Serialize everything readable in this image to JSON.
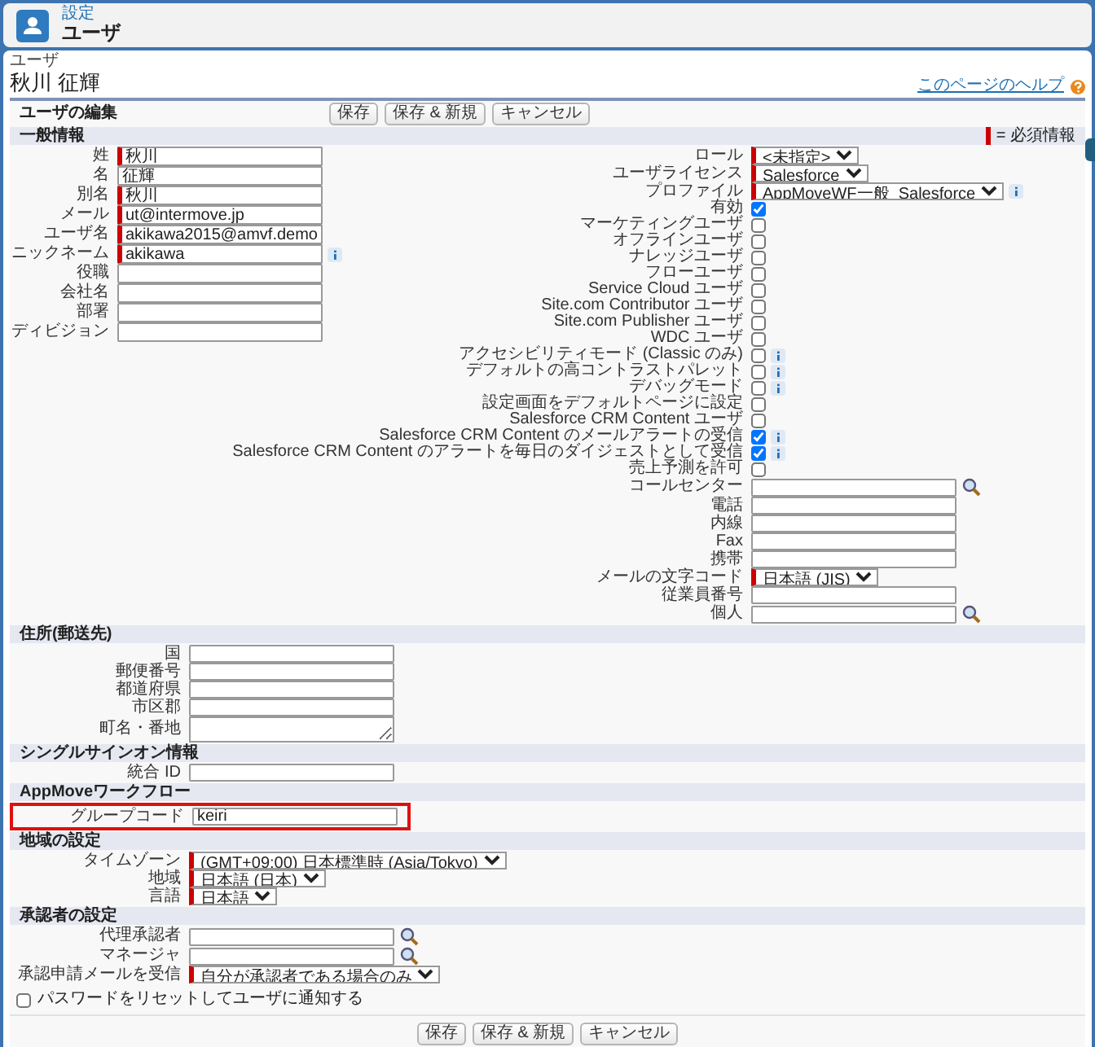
{
  "header": {
    "breadcrumb": "設定",
    "title": "ユーザ"
  },
  "record": {
    "type_label": "ユーザ",
    "name": "秋川 征輝",
    "help_link": "このページのヘルプ"
  },
  "edit_bar": {
    "title": "ユーザの編集",
    "buttons": [
      "保存",
      "保存 & 新規",
      "キャンセル"
    ]
  },
  "sections": [
    {
      "title": "一般情報",
      "required_legend": "= 必須情報",
      "left_fields": [
        {
          "kind": "text",
          "label": "姓",
          "value": "秋川",
          "required": true
        },
        {
          "kind": "text",
          "label": "名",
          "value": "征輝",
          "required": false
        },
        {
          "kind": "text",
          "label": "別名",
          "value": "秋川",
          "required": true
        },
        {
          "kind": "text",
          "label": "メール",
          "value": "ut@intermove.jp",
          "required": true
        },
        {
          "kind": "text",
          "label": "ユーザ名",
          "value": "akikawa2015@amvf.demo",
          "required": true
        },
        {
          "kind": "text",
          "label": "ニックネーム",
          "value": "akikawa",
          "required": true,
          "info": true
        },
        {
          "kind": "text",
          "label": "役職",
          "required": false
        },
        {
          "kind": "text",
          "label": "会社名",
          "required": false
        },
        {
          "kind": "text",
          "label": "部署",
          "required": false
        },
        {
          "kind": "text",
          "label": "ディビジョン",
          "required": false
        }
      ],
      "right_fields": [
        {
          "kind": "select",
          "label": "ロール",
          "value": "<未指定>",
          "required": true
        },
        {
          "kind": "select",
          "label": "ユーザライセンス",
          "value": "Salesforce",
          "required": true
        },
        {
          "kind": "select",
          "label": "プロファイル",
          "value": "AppMoveWF一般_Salesforce",
          "required": true,
          "info": true
        },
        {
          "kind": "checkbox",
          "label": "有効",
          "checked": true
        },
        {
          "kind": "checkbox",
          "label": "マーケティングユーザ",
          "checked": false
        },
        {
          "kind": "checkbox",
          "label": "オフラインユーザ",
          "checked": false
        },
        {
          "kind": "checkbox",
          "label": "ナレッジユーザ",
          "checked": false
        },
        {
          "kind": "checkbox",
          "label": "フローユーザ",
          "checked": false
        },
        {
          "kind": "checkbox",
          "label": "Service Cloud ユーザ",
          "checked": false
        },
        {
          "kind": "checkbox",
          "label": "Site.com Contributor ユーザ",
          "checked": false
        },
        {
          "kind": "checkbox",
          "label": "Site.com Publisher ユーザ",
          "checked": false
        },
        {
          "kind": "checkbox",
          "label": "WDC ユーザ",
          "checked": false
        },
        {
          "kind": "checkbox",
          "label": "アクセシビリティモード (Classic のみ)",
          "checked": false,
          "info": true
        },
        {
          "kind": "checkbox",
          "label": "デフォルトの高コントラストパレット",
          "checked": false,
          "info": true
        },
        {
          "kind": "checkbox",
          "label": "デバッグモード",
          "checked": false,
          "info": true
        },
        {
          "kind": "checkbox",
          "label": "設定画面をデフォルトページに設定",
          "checked": false
        },
        {
          "kind": "checkbox",
          "label": "Salesforce CRM Content ユーザ",
          "checked": false
        },
        {
          "kind": "checkbox",
          "label": "Salesforce CRM Content のメールアラートの受信",
          "checked": true,
          "info": true
        },
        {
          "kind": "checkbox",
          "label": "Salesforce CRM Content のアラートを毎日のダイジェストとして受信",
          "checked": true,
          "info": true
        },
        {
          "kind": "checkbox",
          "label": "売上予測を許可",
          "checked": false
        },
        {
          "kind": "lookup",
          "label": "コールセンター",
          "required": false
        },
        {
          "kind": "text",
          "label": "電話",
          "required": false
        },
        {
          "kind": "text",
          "label": "内線",
          "required": false
        },
        {
          "kind": "text",
          "label": "Fax",
          "required": false
        },
        {
          "kind": "text",
          "label": "携帯",
          "required": false
        },
        {
          "kind": "select",
          "label": "メールの文字コード",
          "value": "日本語 (JIS)",
          "required": true
        },
        {
          "kind": "text",
          "label": "従業員番号",
          "required": false
        },
        {
          "kind": "lookup",
          "label": "個人",
          "required": false
        }
      ]
    },
    {
      "title": "住所(郵送先)",
      "fields": [
        {
          "kind": "text",
          "label": "国",
          "required": false
        },
        {
          "kind": "text",
          "label": "郵便番号",
          "required": false
        },
        {
          "kind": "text",
          "label": "都道府県",
          "required": false
        },
        {
          "kind": "text",
          "label": "市区郡",
          "required": false
        },
        {
          "kind": "textarea",
          "label": "町名・番地",
          "required": false
        }
      ]
    },
    {
      "title": "シングルサインオン情報",
      "fields": [
        {
          "kind": "text",
          "label": "統合 ID",
          "required": false
        }
      ]
    },
    {
      "title": "AppMoveワークフロー",
      "fields": [
        {
          "kind": "text",
          "label": "グループコード",
          "value": "keiri",
          "required": false,
          "highlighted": true
        }
      ]
    },
    {
      "title": "地域の設定",
      "fields": [
        {
          "kind": "select",
          "label": "タイムゾーン",
          "value": "(GMT+09:00) 日本標準時 (Asia/Tokyo)",
          "required": true
        },
        {
          "kind": "select",
          "label": "地域",
          "value": "日本語 (日本)",
          "required": true
        },
        {
          "kind": "select",
          "label": "言語",
          "value": "日本語",
          "required": true
        }
      ]
    },
    {
      "title": "承認者の設定",
      "fields": [
        {
          "kind": "lookup",
          "label": "代理承認者",
          "required": false
        },
        {
          "kind": "lookup",
          "label": "マネージャ",
          "required": false
        },
        {
          "kind": "select",
          "label": "承認申請メールを受信",
          "value": "自分が承認者である場合のみ",
          "required": true
        }
      ]
    }
  ],
  "notify_option": {
    "label": "パスワードをリセットしてユーザに通知する",
    "checked": false
  },
  "bottom_buttons": [
    "保存",
    "保存 & 新規",
    "キャンセル"
  ]
}
